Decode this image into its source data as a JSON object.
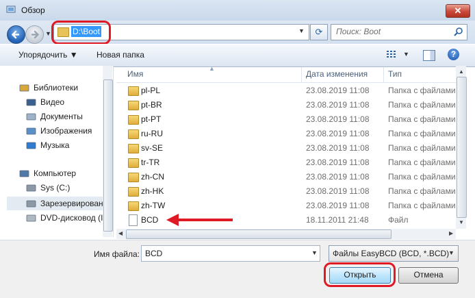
{
  "window": {
    "title": "Обзор",
    "close_label": "✕"
  },
  "address": {
    "path": "D:\\Boot"
  },
  "search": {
    "placeholder": "Поиск: Boot"
  },
  "toolbar": {
    "organize_label": "Упорядочить ▼",
    "new_folder_label": "Новая папка"
  },
  "nav": {
    "items": [
      {
        "label": "Библиотеки",
        "icon": "libraries-icon"
      },
      {
        "label": "Видео",
        "icon": "video-icon"
      },
      {
        "label": "Документы",
        "icon": "documents-icon"
      },
      {
        "label": "Изображения",
        "icon": "pictures-icon"
      },
      {
        "label": "Музыка",
        "icon": "music-icon"
      },
      {
        "label": "Компьютер",
        "icon": "computer-icon"
      },
      {
        "label": "Sys (C:)",
        "icon": "drive-icon"
      },
      {
        "label": "Зарезервирован",
        "icon": "drive-icon"
      },
      {
        "label": "DVD-дисковод (I",
        "icon": "dvd-icon"
      }
    ]
  },
  "columns": {
    "name": "Имя",
    "date": "Дата изменения",
    "type": "Тип"
  },
  "files": [
    {
      "name": "pl-PL",
      "date": "23.08.2019 11:08",
      "type": "Папка с файлами",
      "kind": "folder"
    },
    {
      "name": "pt-BR",
      "date": "23.08.2019 11:08",
      "type": "Папка с файлами",
      "kind": "folder"
    },
    {
      "name": "pt-PT",
      "date": "23.08.2019 11:08",
      "type": "Папка с файлами",
      "kind": "folder"
    },
    {
      "name": "ru-RU",
      "date": "23.08.2019 11:08",
      "type": "Папка с файлами",
      "kind": "folder"
    },
    {
      "name": "sv-SE",
      "date": "23.08.2019 11:08",
      "type": "Папка с файлами",
      "kind": "folder"
    },
    {
      "name": "tr-TR",
      "date": "23.08.2019 11:08",
      "type": "Папка с файлами",
      "kind": "folder"
    },
    {
      "name": "zh-CN",
      "date": "23.08.2019 11:08",
      "type": "Папка с файлами",
      "kind": "folder"
    },
    {
      "name": "zh-HK",
      "date": "23.08.2019 11:08",
      "type": "Папка с файлами",
      "kind": "folder"
    },
    {
      "name": "zh-TW",
      "date": "23.08.2019 11:08",
      "type": "Папка с файлами",
      "kind": "folder"
    },
    {
      "name": "BCD",
      "date": "18.11.2011 21:48",
      "type": "Файл",
      "kind": "file"
    }
  ],
  "bottom": {
    "filename_label": "Имя файла:",
    "filename_value": "BCD",
    "filter_value": "Файлы EasyBCD (BCD, *.BCD)",
    "open_label": "Открыть",
    "cancel_label": "Отмена"
  },
  "colors": {
    "annotation": "#e01a24",
    "selection": "#3399ff"
  }
}
